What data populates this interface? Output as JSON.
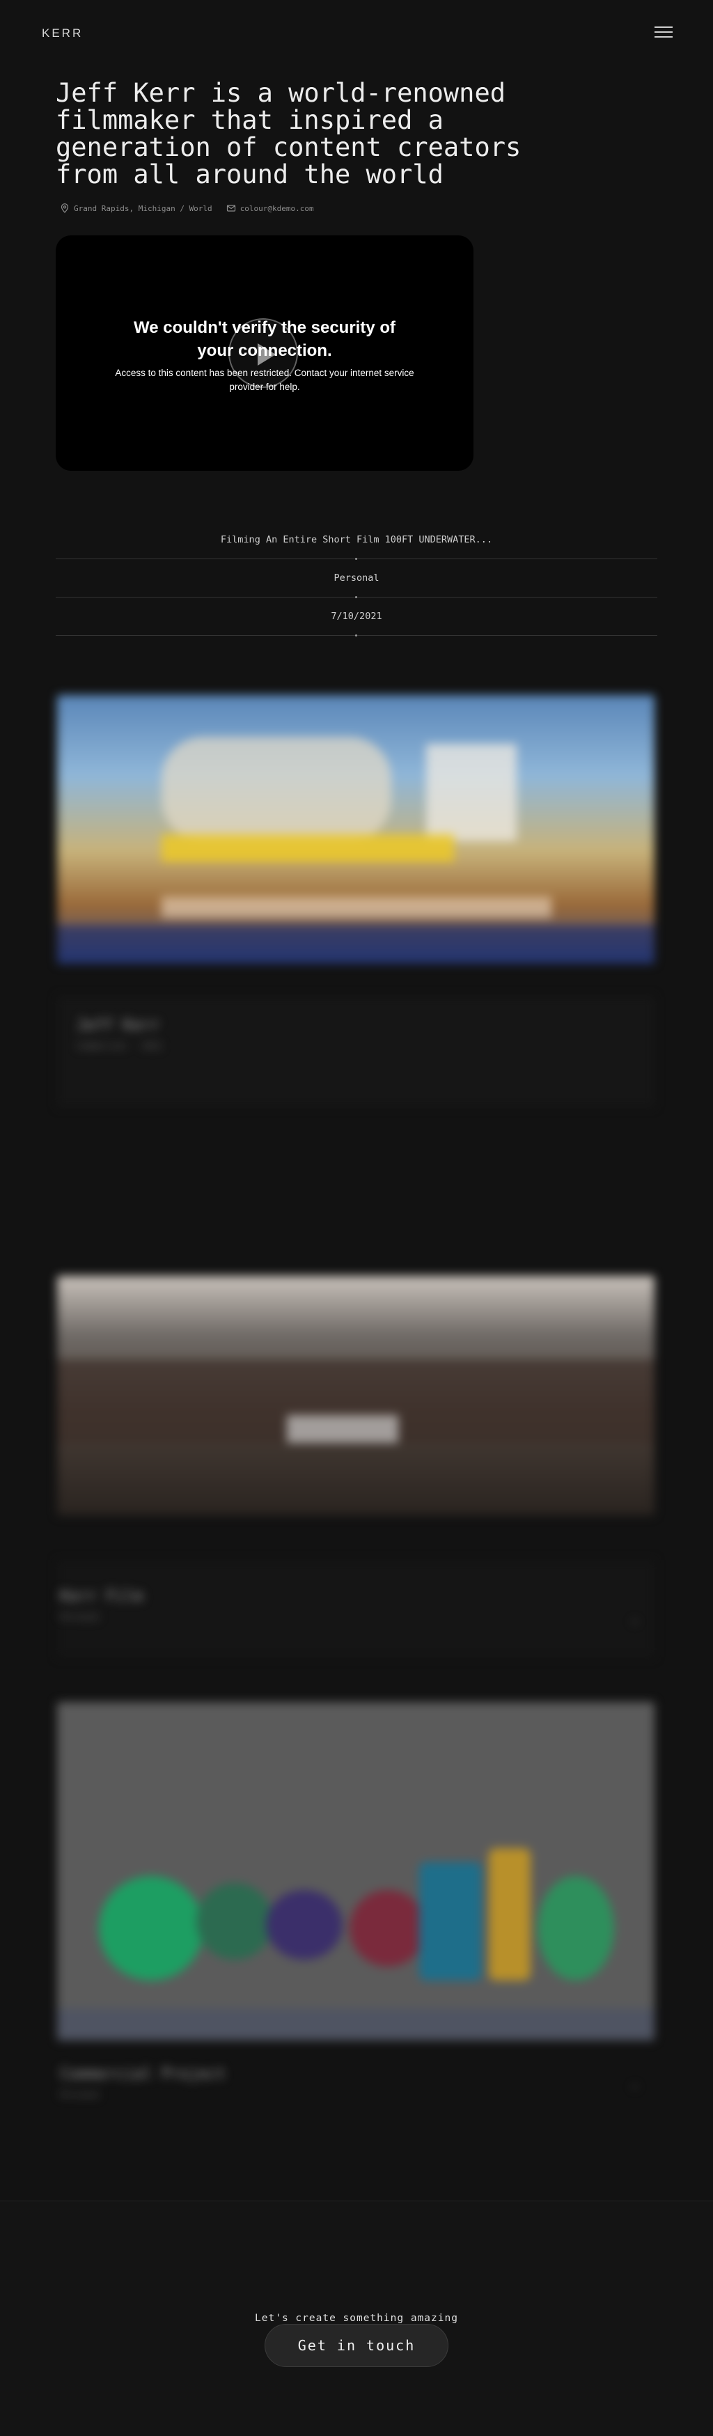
{
  "header": {
    "logo": "KERR",
    "menu_icon": "hamburger-menu-icon"
  },
  "hero": {
    "title": "Jeff Kerr is a world-renowned filmmaker that inspired a generation of content creators from all around the world",
    "location": "Grand Rapids, Michigan / World",
    "email": "colour@kdemo.com",
    "location_icon": "map-pin-icon",
    "email_icon": "mail-icon"
  },
  "video": {
    "error_title": "We couldn't verify the security of your connection.",
    "error_body": "Access to this content has been restricted. Contact your internet service provider for help.",
    "play_icon": "play-icon"
  },
  "project_info": {
    "title": "Filming An Entire Short Film 100FT UNDERWATER...",
    "category": "Personal",
    "date": "7/10/2021"
  },
  "projects": [
    {
      "title": "Jeff Kerr",
      "subtitle": "Commercial · 2021"
    },
    {
      "title": "Kerr Film",
      "subtitle": "Personal"
    },
    {
      "title": "Commercial Project",
      "subtitle": "Personal"
    }
  ],
  "footer": {
    "tagline": "Let's create something amazing",
    "cta": "Get in touch"
  }
}
